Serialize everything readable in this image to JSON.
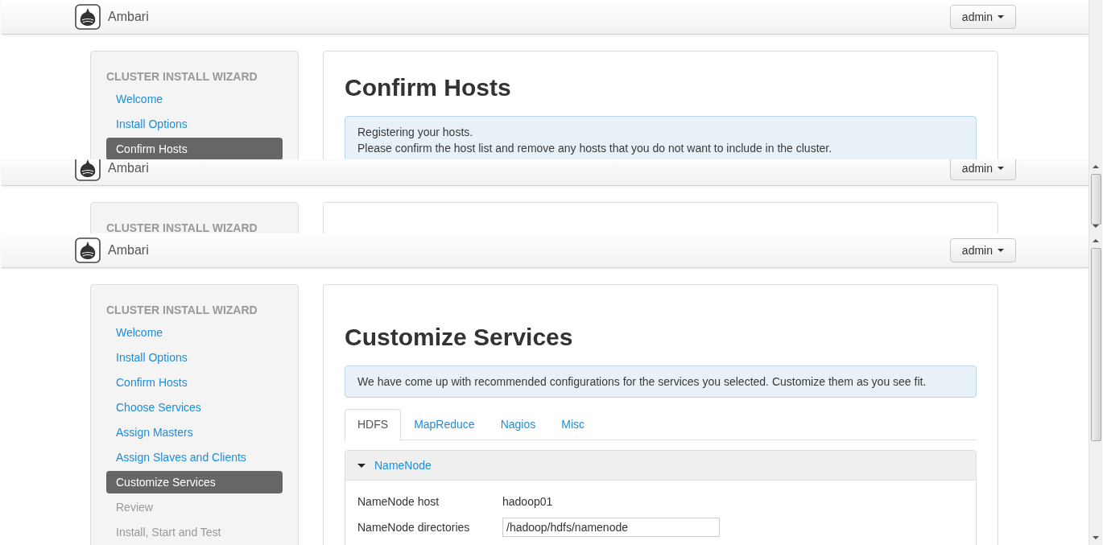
{
  "frames": [
    {
      "scrollbar": false,
      "header": {
        "brand": "Ambari",
        "user_menu": "admin"
      },
      "wizard": {
        "title": "CLUSTER INSTALL WIZARD",
        "steps": [
          {
            "label": "Welcome",
            "selected": false,
            "disabled": false
          },
          {
            "label": "Install Options",
            "selected": false,
            "disabled": false
          },
          {
            "label": "Confirm Hosts",
            "selected": true,
            "disabled": false
          }
        ]
      },
      "content": {
        "heading": "Confirm Hosts",
        "alert": [
          "Registering your hosts.",
          "Please confirm the host list and remove any hosts that you do not want to include in the cluster."
        ]
      }
    },
    {
      "scrollbar": true,
      "header": {
        "brand": "Ambari",
        "user_menu": "admin"
      },
      "wizard": {
        "title": "CLUSTER INSTALL WIZARD"
      }
    },
    {
      "scrollbar": true,
      "header": {
        "brand": "Ambari",
        "user_menu": "admin"
      },
      "wizard": {
        "title": "CLUSTER INSTALL WIZARD",
        "steps": [
          {
            "label": "Welcome",
            "selected": false,
            "disabled": false
          },
          {
            "label": "Install Options",
            "selected": false,
            "disabled": false
          },
          {
            "label": "Confirm Hosts",
            "selected": false,
            "disabled": false
          },
          {
            "label": "Choose Services",
            "selected": false,
            "disabled": false
          },
          {
            "label": "Assign Masters",
            "selected": false,
            "disabled": false
          },
          {
            "label": "Assign Slaves and Clients",
            "selected": false,
            "disabled": false
          },
          {
            "label": "Customize Services",
            "selected": true,
            "disabled": false
          },
          {
            "label": "Review",
            "selected": false,
            "disabled": true
          },
          {
            "label": "Install, Start and Test",
            "selected": false,
            "disabled": true
          }
        ]
      },
      "content": {
        "heading": "Customize Services",
        "alert": [
          "We have come up with recommended configurations for the services you selected. Customize them as you see fit."
        ],
        "tabs": [
          {
            "label": "HDFS",
            "selected": true
          },
          {
            "label": "MapReduce",
            "selected": false
          },
          {
            "label": "Nagios",
            "selected": false
          },
          {
            "label": "Misc",
            "selected": false
          }
        ],
        "section": {
          "title": "NameNode",
          "expanded": true,
          "fields": [
            {
              "kind": "text",
              "label": "NameNode host",
              "value": "hadoop01"
            },
            {
              "kind": "input",
              "label": "NameNode directories",
              "value": "/hadoop/hdfs/namenode"
            }
          ]
        }
      }
    }
  ]
}
